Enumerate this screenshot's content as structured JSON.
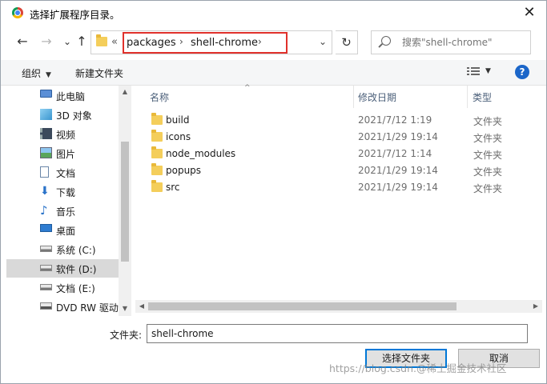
{
  "window": {
    "title": "选择扩展程序目录。",
    "close_glyph": "✕"
  },
  "nav": {
    "back_glyph": "←",
    "forward_glyph": "→",
    "recent_glyph": "⌄",
    "up_glyph": "↑",
    "address": {
      "overflow_glyph": "«",
      "breadcrumbs": [
        "packages",
        "shell-chrome"
      ],
      "sep_glyph": "›",
      "dropdown_glyph": "⌄"
    },
    "refresh_glyph": "↻",
    "search": {
      "placeholder": "搜索\"shell-chrome\""
    }
  },
  "toolbar": {
    "organize_label": "组织",
    "organize_arrow": "▼",
    "new_folder_label": "新建文件夹",
    "view_arrow": "▼",
    "help_glyph": "?"
  },
  "sidebar": {
    "items": [
      {
        "label": "此电脑",
        "icon": "computer-icon"
      },
      {
        "label": "3D 对象",
        "icon": "cube-icon"
      },
      {
        "label": "视频",
        "icon": "video-icon"
      },
      {
        "label": "图片",
        "icon": "picture-icon"
      },
      {
        "label": "文档",
        "icon": "document-icon"
      },
      {
        "label": "下载",
        "icon": "download-icon"
      },
      {
        "label": "音乐",
        "icon": "music-icon"
      },
      {
        "label": "桌面",
        "icon": "desktop-icon"
      },
      {
        "label": "系统 (C:)",
        "icon": "drive-icon"
      },
      {
        "label": "软件 (D:)",
        "icon": "drive-icon",
        "selected": true
      },
      {
        "label": "文档 (E:)",
        "icon": "drive-icon"
      },
      {
        "label": "DVD RW 驱动",
        "icon": "dvd-icon"
      }
    ]
  },
  "files": {
    "columns": {
      "name": "名称",
      "date": "修改日期",
      "type": "类型",
      "sort_glyph": "^"
    },
    "rows": [
      {
        "name": "build",
        "date": "2021/7/12 1:19",
        "type": "文件夹"
      },
      {
        "name": "icons",
        "date": "2021/1/29 19:14",
        "type": "文件夹"
      },
      {
        "name": "node_modules",
        "date": "2021/7/12 1:14",
        "type": "文件夹"
      },
      {
        "name": "popups",
        "date": "2021/1/29 19:14",
        "type": "文件夹"
      },
      {
        "name": "src",
        "date": "2021/1/29 19:14",
        "type": "文件夹"
      }
    ]
  },
  "scroll": {
    "up": "▲",
    "down": "▼",
    "left": "◀",
    "right": "▶"
  },
  "footer": {
    "folder_label": "文件夹:",
    "folder_value": "shell-chrome",
    "select_label": "选择文件夹",
    "cancel_label": "取消",
    "watermark": "https://blog.csdn.@稀土掘金技术社区"
  },
  "colors": {
    "accent": "#0078d7",
    "highlight_border": "#e0312b",
    "folder": "#f4ce5b"
  }
}
